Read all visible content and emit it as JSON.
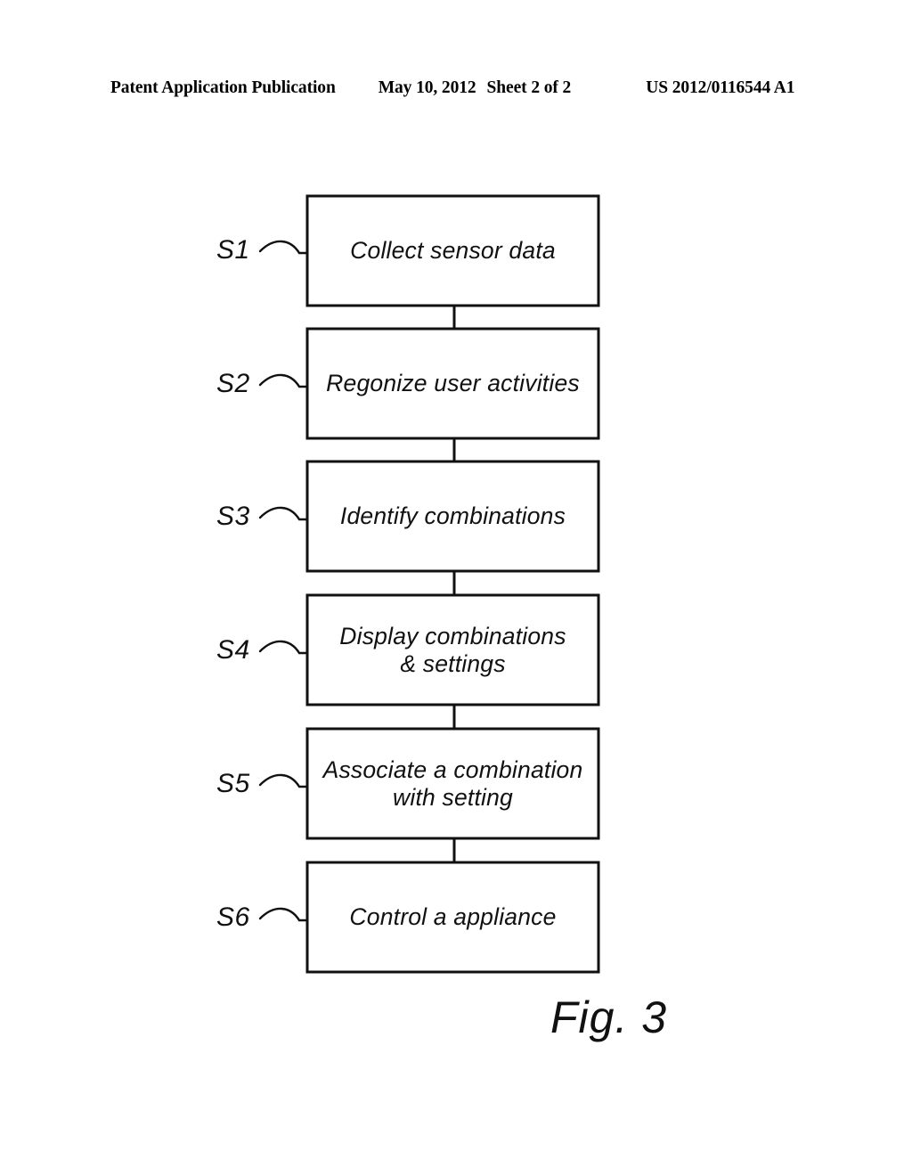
{
  "header": {
    "publication": "Patent Application Publication",
    "date": "May 10, 2012",
    "sheet": "Sheet 2 of 2",
    "doc_number": "US 2012/0116544 A1"
  },
  "figure": {
    "caption": "Fig. 3",
    "type": "flowchart",
    "orientation": "vertical",
    "steps": [
      {
        "ref": "S1",
        "text": "Collect sensor data"
      },
      {
        "ref": "S2",
        "text": "Regonize user activities"
      },
      {
        "ref": "S3",
        "text": "Identify combinations"
      },
      {
        "ref": "S4",
        "text": "Display combinations\n& settings"
      },
      {
        "ref": "S5",
        "text": "Associate a combination\nwith setting"
      },
      {
        "ref": "S6",
        "text": "Control a appliance"
      }
    ]
  },
  "style": {
    "ink": "#111111",
    "paper": "#ffffff"
  }
}
